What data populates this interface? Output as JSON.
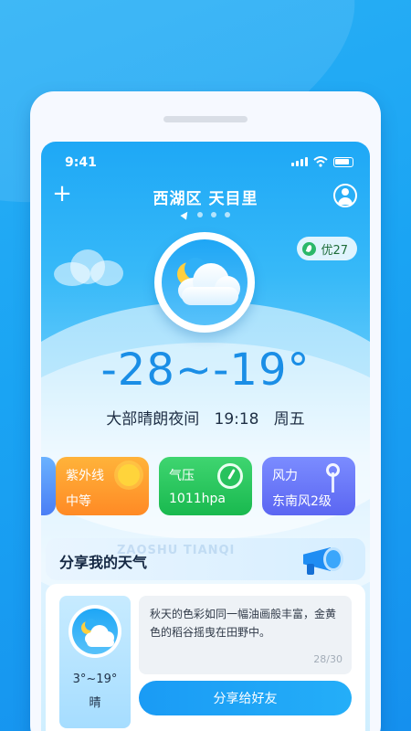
{
  "status_bar": {
    "time": "9:41"
  },
  "header": {
    "add_label": "+",
    "location": "西湖区 天目里"
  },
  "aqi": {
    "label": "优27"
  },
  "weather": {
    "icon": "moon-cloud-icon",
    "temperature": "-28~-19°",
    "description": "大部晴朗夜间",
    "time": "19:18",
    "weekday": "周五"
  },
  "cards": [
    {
      "title": "紫外线",
      "value": "中等",
      "icon": "sun-icon"
    },
    {
      "title": "气压",
      "value": "1011hpa",
      "icon": "gauge-icon"
    },
    {
      "title": "风力",
      "value": "东南风2级",
      "icon": "windmill-icon"
    }
  ],
  "share": {
    "title": "分享我的天气",
    "watermark": "ZAOSHU TIANQI",
    "card_temp": "3°~19°",
    "card_condition": "晴",
    "text": "秋天的色彩如同一幅油画般丰富，金黄色的稻谷摇曳在田野中。",
    "counter": "28/30",
    "button_label": "分享给好友"
  },
  "colors": {
    "primary": "#1a9bf5",
    "temp_text": "#1a8ee6",
    "uv_card": "#ff9a2e",
    "pressure_card": "#24c15a",
    "wind_card": "#6a74f7"
  }
}
